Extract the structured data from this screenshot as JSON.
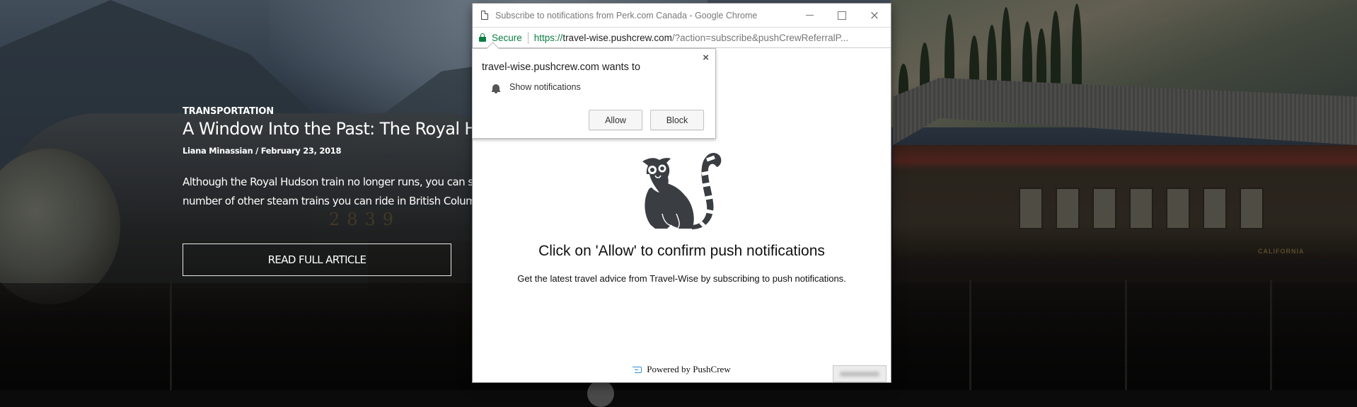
{
  "background_page": {
    "article": {
      "category": "TRANSPORTATION",
      "title": "A Window Into the Past: The Royal Hudson",
      "byline": "Liana Minassian / February 23, 2018",
      "excerpt_lines": [
        "Although the Royal Hudson train no longer runs, you can still",
        "number of other steam trains you can ride in British Columbia"
      ],
      "read_button": "READ FULL ARTICLE"
    },
    "photo": {
      "locomotive_number": "2839",
      "railcar_label": "CALIFORNIA"
    }
  },
  "popup_window": {
    "title": "Subscribe to notifications from Perk.com Canada - Google Chrome",
    "controls": {
      "minimize": "minimize",
      "maximize": "maximize",
      "close": "×"
    },
    "address_bar": {
      "security_label": "Secure",
      "url_scheme": "https://",
      "url_host": "travel-wise.pushcrew.com",
      "url_rest": "/?action=subscribe&pushCrewReferralP..."
    },
    "permission_prompt": {
      "origin_text": "travel-wise.pushcrew.com wants to",
      "permission": "Show notifications",
      "close": "×",
      "allow_label": "Allow",
      "block_label": "Block"
    },
    "content": {
      "headline": "Click on 'Allow' to confirm push notifications",
      "subtext": "Get the latest travel advice from Travel-Wise by subscribing to push notifications.",
      "powered_by": "Powered by PushCrew"
    }
  },
  "colors": {
    "secure_green": "#0b8043",
    "pushcrew_blue": "#2f8fe0"
  }
}
